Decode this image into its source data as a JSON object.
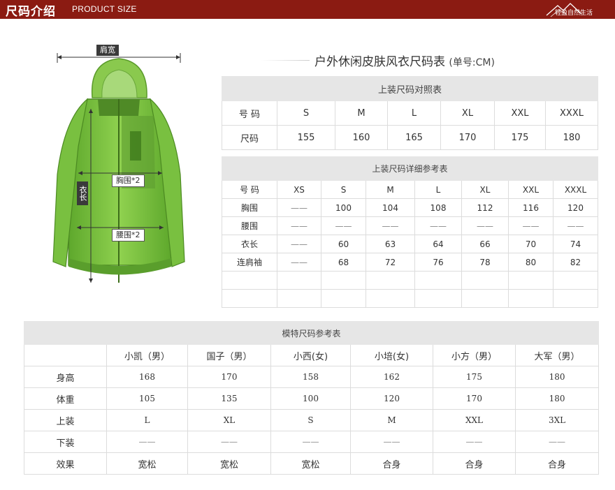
{
  "header": {
    "title_cn": "尺码介绍",
    "title_en": "PRODUCT SIZE",
    "logo_text": "轻盈自然生活",
    "bg_color": "#8b1b12"
  },
  "jacket": {
    "color": "#7bc442",
    "label_shoulder": "肩宽",
    "label_chest": "胸围*2",
    "label_length": "衣长",
    "label_waist": "腰围*2"
  },
  "title": {
    "main": "户外休闲皮肤风衣尺码表",
    "unit": "(单号:CM)"
  },
  "table1": {
    "caption": "上装尺码对照表",
    "rows": [
      [
        "号 码",
        "S",
        "M",
        "L",
        "XL",
        "XXL",
        "XXXL"
      ],
      [
        "尺码",
        "155",
        "160",
        "165",
        "170",
        "175",
        "180"
      ]
    ]
  },
  "table2": {
    "caption": "上装尺码详细参考表",
    "rows": [
      [
        "号 码",
        "XS",
        "S",
        "M",
        "L",
        "XL",
        "XXL",
        "XXXL"
      ],
      [
        "胸围",
        "——",
        "100",
        "104",
        "108",
        "112",
        "116",
        "120"
      ],
      [
        "腰围",
        "——",
        "——",
        "——",
        "——",
        "——",
        "——",
        "——"
      ],
      [
        "衣长",
        "——",
        "60",
        "63",
        "64",
        "66",
        "70",
        "74"
      ],
      [
        "连肩袖",
        "——",
        "68",
        "72",
        "76",
        "78",
        "80",
        "82"
      ],
      [
        "",
        "",
        "",
        "",
        "",
        "",
        "",
        ""
      ],
      [
        "",
        "",
        "",
        "",
        "",
        "",
        "",
        ""
      ]
    ]
  },
  "table3": {
    "caption": "模特尺码参考表",
    "columns": [
      "",
      "小凯（男）",
      "国子（男）",
      "小西(女)",
      "小培(女)",
      "小方（男）",
      "大军（男）"
    ],
    "rows": [
      [
        "身高",
        "168",
        "170",
        "158",
        "162",
        "175",
        "180"
      ],
      [
        "体重",
        "105",
        "135",
        "100",
        "120",
        "170",
        "180"
      ],
      [
        "上装",
        "L",
        "XL",
        "S",
        "M",
        "XXL",
        "3XL"
      ],
      [
        "下装",
        "——",
        "——",
        "——",
        "——",
        "——",
        "——"
      ],
      [
        "效果",
        "宽松",
        "宽松",
        "宽松",
        "合身",
        "合身",
        "合身"
      ]
    ]
  }
}
